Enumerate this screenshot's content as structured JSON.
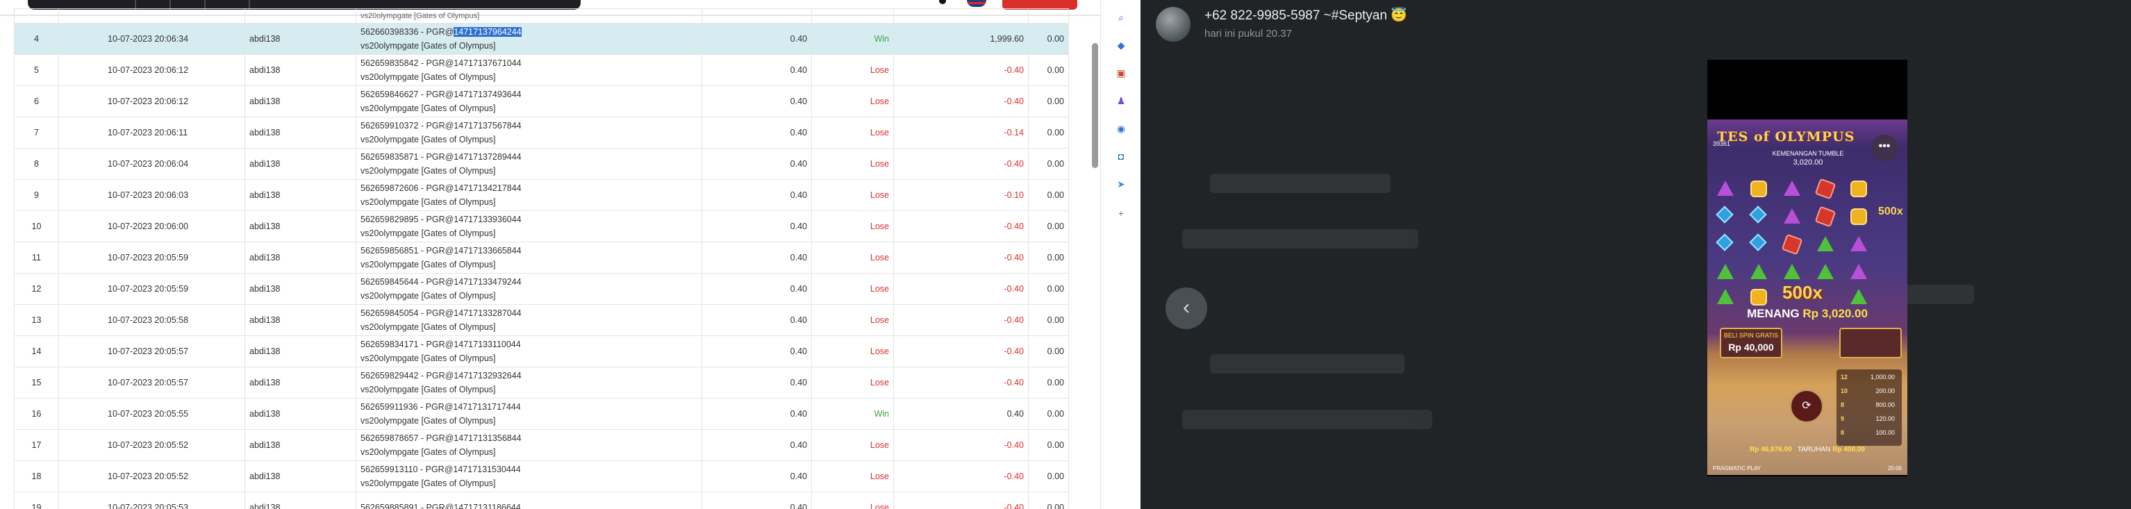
{
  "rows": [
    {
      "no": "",
      "date": "",
      "user": "",
      "detail_id": "",
      "detail_game": "vs20olympgate [Gates of Olympus]",
      "bet": "",
      "result": "",
      "winloss": "",
      "last": ""
    },
    {
      "no": "4",
      "date": "10-07-2023 20:06:34",
      "user": "abdi138",
      "detail_id": "562660398336 - PGR@",
      "detail_sel": "14717137964244",
      "detail_game": "vs20olympgate [Gates of Olympus]",
      "bet": "0.40",
      "result": "Win",
      "winloss": "1,999.60",
      "last": "0.00"
    },
    {
      "no": "5",
      "date": "10-07-2023 20:06:12",
      "user": "abdi138",
      "detail_id": "562659835842 - PGR@14717137671044",
      "detail_game": "vs20olympgate [Gates of Olympus]",
      "bet": "0.40",
      "result": "Lose",
      "winloss": "-0.40",
      "last": "0.00"
    },
    {
      "no": "6",
      "date": "10-07-2023 20:06:12",
      "user": "abdi138",
      "detail_id": "562659846627 - PGR@14717137493644",
      "detail_game": "vs20olympgate [Gates of Olympus]",
      "bet": "0.40",
      "result": "Lose",
      "winloss": "-0.40",
      "last": "0.00"
    },
    {
      "no": "7",
      "date": "10-07-2023 20:06:11",
      "user": "abdi138",
      "detail_id": "562659910372 - PGR@14717137567844",
      "detail_game": "vs20olympgate [Gates of Olympus]",
      "bet": "0.40",
      "result": "Lose",
      "winloss": "-0.14",
      "last": "0.00"
    },
    {
      "no": "8",
      "date": "10-07-2023 20:06:04",
      "user": "abdi138",
      "detail_id": "562659835871 - PGR@14717137289444",
      "detail_game": "vs20olympgate [Gates of Olympus]",
      "bet": "0.40",
      "result": "Lose",
      "winloss": "-0.40",
      "last": "0.00"
    },
    {
      "no": "9",
      "date": "10-07-2023 20:06:03",
      "user": "abdi138",
      "detail_id": "562659872606 - PGR@14717134217844",
      "detail_game": "vs20olympgate [Gates of Olympus]",
      "bet": "0.40",
      "result": "Lose",
      "winloss": "-0.10",
      "last": "0.00"
    },
    {
      "no": "10",
      "date": "10-07-2023 20:06:00",
      "user": "abdi138",
      "detail_id": "562659829895 - PGR@14717133936044",
      "detail_game": "vs20olympgate [Gates of Olympus]",
      "bet": "0.40",
      "result": "Lose",
      "winloss": "-0.40",
      "last": "0.00"
    },
    {
      "no": "11",
      "date": "10-07-2023 20:05:59",
      "user": "abdi138",
      "detail_id": "562659856851 - PGR@14717133665844",
      "detail_game": "vs20olympgate [Gates of Olympus]",
      "bet": "0.40",
      "result": "Lose",
      "winloss": "-0.40",
      "last": "0.00"
    },
    {
      "no": "12",
      "date": "10-07-2023 20:05:59",
      "user": "abdi138",
      "detail_id": "562659845644 - PGR@14717133479244",
      "detail_game": "vs20olympgate [Gates of Olympus]",
      "bet": "0.40",
      "result": "Lose",
      "winloss": "-0.40",
      "last": "0.00"
    },
    {
      "no": "13",
      "date": "10-07-2023 20:05:58",
      "user": "abdi138",
      "detail_id": "562659845054 - PGR@14717133287044",
      "detail_game": "vs20olympgate [Gates of Olympus]",
      "bet": "0.40",
      "result": "Lose",
      "winloss": "-0.40",
      "last": "0.00"
    },
    {
      "no": "14",
      "date": "10-07-2023 20:05:57",
      "user": "abdi138",
      "detail_id": "562659834171 - PGR@14717133110044",
      "detail_game": "vs20olympgate [Gates of Olympus]",
      "bet": "0.40",
      "result": "Lose",
      "winloss": "-0.40",
      "last": "0.00"
    },
    {
      "no": "15",
      "date": "10-07-2023 20:05:57",
      "user": "abdi138",
      "detail_id": "562659829442 - PGR@14717132932644",
      "detail_game": "vs20olympgate [Gates of Olympus]",
      "bet": "0.40",
      "result": "Lose",
      "winloss": "-0.40",
      "last": "0.00"
    },
    {
      "no": "16",
      "date": "10-07-2023 20:05:55",
      "user": "abdi138",
      "detail_id": "562659911936 - PGR@14717131717444",
      "detail_game": "vs20olympgate [Gates of Olympus]",
      "bet": "0.40",
      "result": "Win",
      "winloss": "0.40",
      "last": "0.00"
    },
    {
      "no": "17",
      "date": "10-07-2023 20:05:52",
      "user": "abdi138",
      "detail_id": "562659878657 - PGR@14717131356844",
      "detail_game": "vs20olympgate [Gates of Olympus]",
      "bet": "0.40",
      "result": "Lose",
      "winloss": "-0.40",
      "last": "0.00"
    },
    {
      "no": "18",
      "date": "10-07-2023 20:05:52",
      "user": "abdi138",
      "detail_id": "562659913110 - PGR@14717131530444",
      "detail_game": "vs20olympgate [Gates of Olympus]",
      "bet": "0.40",
      "result": "Lose",
      "winloss": "-0.40",
      "last": "0.00"
    },
    {
      "no": "19",
      "date": "10-07-2023 20:05:53",
      "user": "abdi138",
      "detail_id": "562659885891 - PGR@14717131186644",
      "detail_game": "",
      "bet": "0.40",
      "result": "Lose",
      "winloss": "-0.40",
      "last": "0.00"
    }
  ],
  "strip_icons": [
    "search-icon",
    "tag-icon",
    "briefcase-icon",
    "chess-icon",
    "circle-icon",
    "outlook-icon",
    "send-icon",
    "plus-icon"
  ],
  "viewer": {
    "sender": "+62 822-9985-5987 ~#Septyan 😇",
    "time": "hari ini pukul 20.37",
    "prev": "‹"
  },
  "game": {
    "title": "TES of OLYMPUS",
    "counter": "39361",
    "tumble_label": "KEMENANGAN TUMBLE",
    "tumble_amount": "3,020.00",
    "multiplier_side": "500x",
    "multiplier_big": "500x",
    "menang_label": "MENANG",
    "menang_amount": "Rp 3,020.00",
    "buy_label": "BELI SPIN GRATIS",
    "buy_amount": "Rp 40,000",
    "paytable": [
      {
        "count": "12",
        "value": "1,000.00"
      },
      {
        "count": "10",
        "value": "200.00"
      },
      {
        "count": "8",
        "value": "800.00"
      },
      {
        "count": "9",
        "value": "120.00"
      },
      {
        "count": "8",
        "value": "100.00"
      }
    ],
    "saldo_label": "Rp 46,876.00",
    "taruhan_label": "TARUHAN",
    "taruhan_amount": "Rp 400.00",
    "footer_left": "PRAGMATIC PLAY",
    "footer_right": "20:06"
  },
  "colors": {
    "win": "#3ea53e",
    "lose": "#d9302c",
    "highlight": "#d7ecf1",
    "viewer_bg": "#202427"
  }
}
